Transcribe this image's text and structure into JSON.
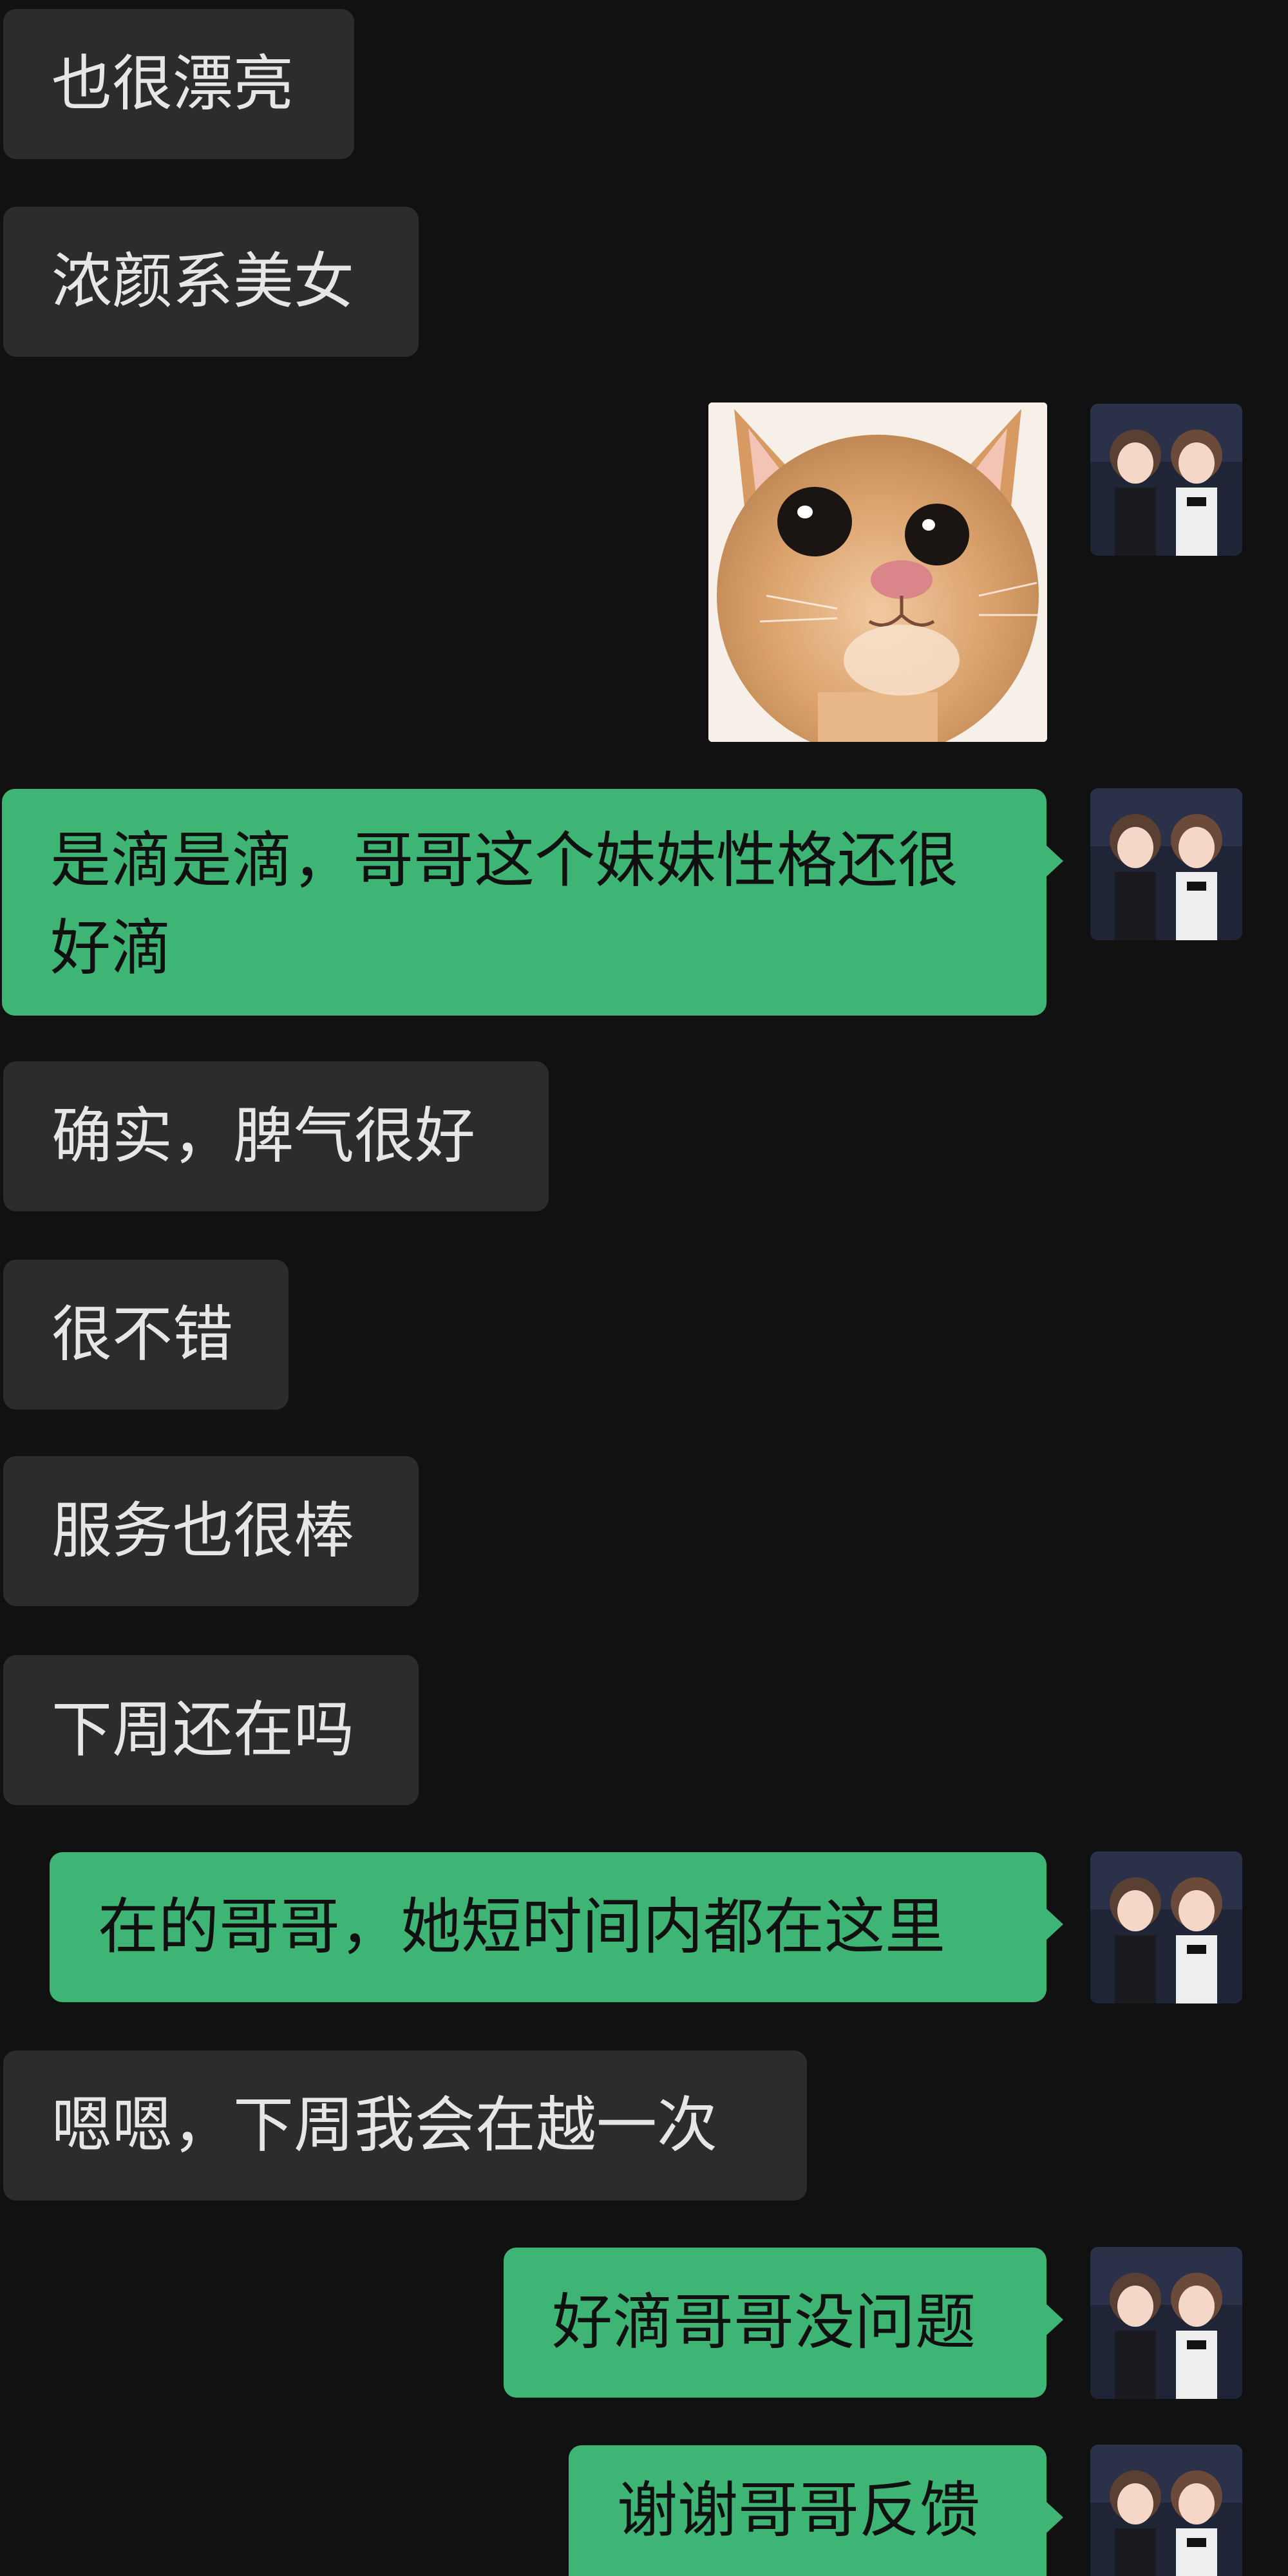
{
  "messages": [
    {
      "side": "received",
      "text": "也很漂亮"
    },
    {
      "side": "received",
      "text": "浓颜系美女"
    },
    {
      "side": "sent",
      "type": "sticker",
      "sticker": "cat-face-sticker"
    },
    {
      "side": "sent",
      "text": "是滴是滴，哥哥这个妹妹性格还很好滴"
    },
    {
      "side": "received",
      "text": "确实，脾气很好"
    },
    {
      "side": "received",
      "text": "很不错"
    },
    {
      "side": "received",
      "text": "服务也很棒"
    },
    {
      "side": "received",
      "text": "下周还在吗"
    },
    {
      "side": "sent",
      "text": "在的哥哥，她短时间内都在这里"
    },
    {
      "side": "received",
      "text": "嗯嗯，下周我会在越一次"
    },
    {
      "side": "sent",
      "text": "好滴哥哥没问题"
    },
    {
      "side": "sent",
      "text": "谢谢哥哥反馈"
    }
  ],
  "colors": {
    "background": "#111111",
    "received_bubble": "#2c2c2c",
    "sent_bubble": "#3eb575",
    "received_text": "#e6e6e6",
    "sent_text": "#101010"
  },
  "icons": {
    "avatar": "two-girls-avatar-icon",
    "sticker": "cat-face-sticker"
  }
}
